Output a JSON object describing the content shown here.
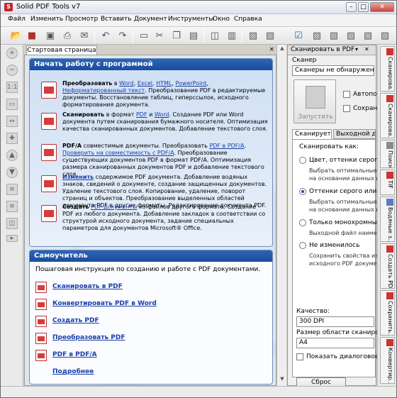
{
  "window": {
    "title": "Solid PDF Tools v7",
    "app_icon": "S",
    "min": "–",
    "max": "□",
    "close": "✕"
  },
  "menu": [
    "Файл",
    "Изменить",
    "Просмотр",
    "Вставить",
    "Документ",
    "Инструменты",
    "Окно",
    "Справка"
  ],
  "start_tab": {
    "label": "Стартовая страница",
    "close": "×"
  },
  "start_box": {
    "header": "Начать работу с программой",
    "items": [
      {
        "lead": "Преобразовать",
        "t1": " в ",
        "l1": "Word",
        ", ": "",
        "l2": "Excel",
        "l3": "HTML",
        "l4": "PowerPoint",
        "l5": "Неформатированный текст",
        "rest": ". Преобразование PDF в редактируемые документы. Восстановление таблиц, гиперссылок, исходного форматирования документа."
      },
      {
        "lead": "Сканировать",
        "t1": " в формат ",
        "l1": "PDF",
        "l2": "Word",
        "rest": ". Создание PDF или Word документа путем сканирования бумажного носителя. Оптимизация качества сканированных документов. Добавление текстового слоя."
      },
      {
        "lead": "PDF/A",
        "t1": " совместимые документы. Преобразовать ",
        "l1": "PDF в PDF/A",
        "l2": "Проверить на совместимость с PDF/A",
        "rest": ". Преобразование существующих документов PDF в формат PDF/A. Оптимизация размера сканированных документов PDF и добавление текстового слоя."
      },
      {
        "lead": "Изменить",
        "rest": " содержимое PDF документа. Добавление водяных знаков, сведений о документе, создание защищенных документов. Удаление текстового слоя. Копирование, удаление, поворот страниц и объектов. Преобразование выделенных областей документа PDF в другие форматы. Редактирование документа PDF."
      },
      {
        "lead": "Создать",
        "l1": "PDF документы",
        "rest": " из файлов другого формата. Создание PDF из любого документа. Добавление закладок в соответствии со структурой исходного документа, задание специальных параметров для документов Microsoft® Office."
      }
    ]
  },
  "tutorial": {
    "header": "Самоучитель",
    "intro": "Пошаговая инструкция по созданию и работе с  PDF документами.",
    "links": [
      "Сканировать в PDF",
      "Конвертировать PDF в Word",
      "Создать PDF",
      "Преобразовать PDF",
      "PDF в PDF/A",
      "Подробнее"
    ]
  },
  "scan_panel": {
    "title": "Сканировать в PDF",
    "scanner_label": "Сканер",
    "scanner_value": "Сканеры не обнаружены",
    "start": "Запустить",
    "autofeed": "Автопод",
    "save": "Сохраня",
    "tabs": [
      "Сканируется",
      "Выходной доку"
    ],
    "scan_as": "Сканировать как:",
    "options": [
      {
        "label": "Цвет, оттенки серого или",
        "desc1": "Выбрать оптимальные п",
        "desc2": "на основании данных ис"
      },
      {
        "label": "Оттенки серого или моно",
        "desc1": "Выбрать оптимальные п",
        "desc2": "на основании данных ис"
      },
      {
        "label": "Только монохромный",
        "desc1": "Выходной файл наимень",
        "desc2": ""
      },
      {
        "label": "Не изменилось",
        "desc1": "Сохранить свойства изоб",
        "desc2": "исходного PDF документа"
      }
    ],
    "quality_label": "Качество:",
    "quality_value": "300 DPI",
    "area_label": "Размер области сканировани",
    "area_value": "A4",
    "dialog_label": "Показать диалоговое окно",
    "reset": "Сброс"
  },
  "vtabs": [
    "Сканирова...",
    "Сканирова...",
    "Поиск",
    "TIF",
    "Водяные з...",
    "Создать PDF",
    "Сохранить...",
    "Конвертир..."
  ]
}
